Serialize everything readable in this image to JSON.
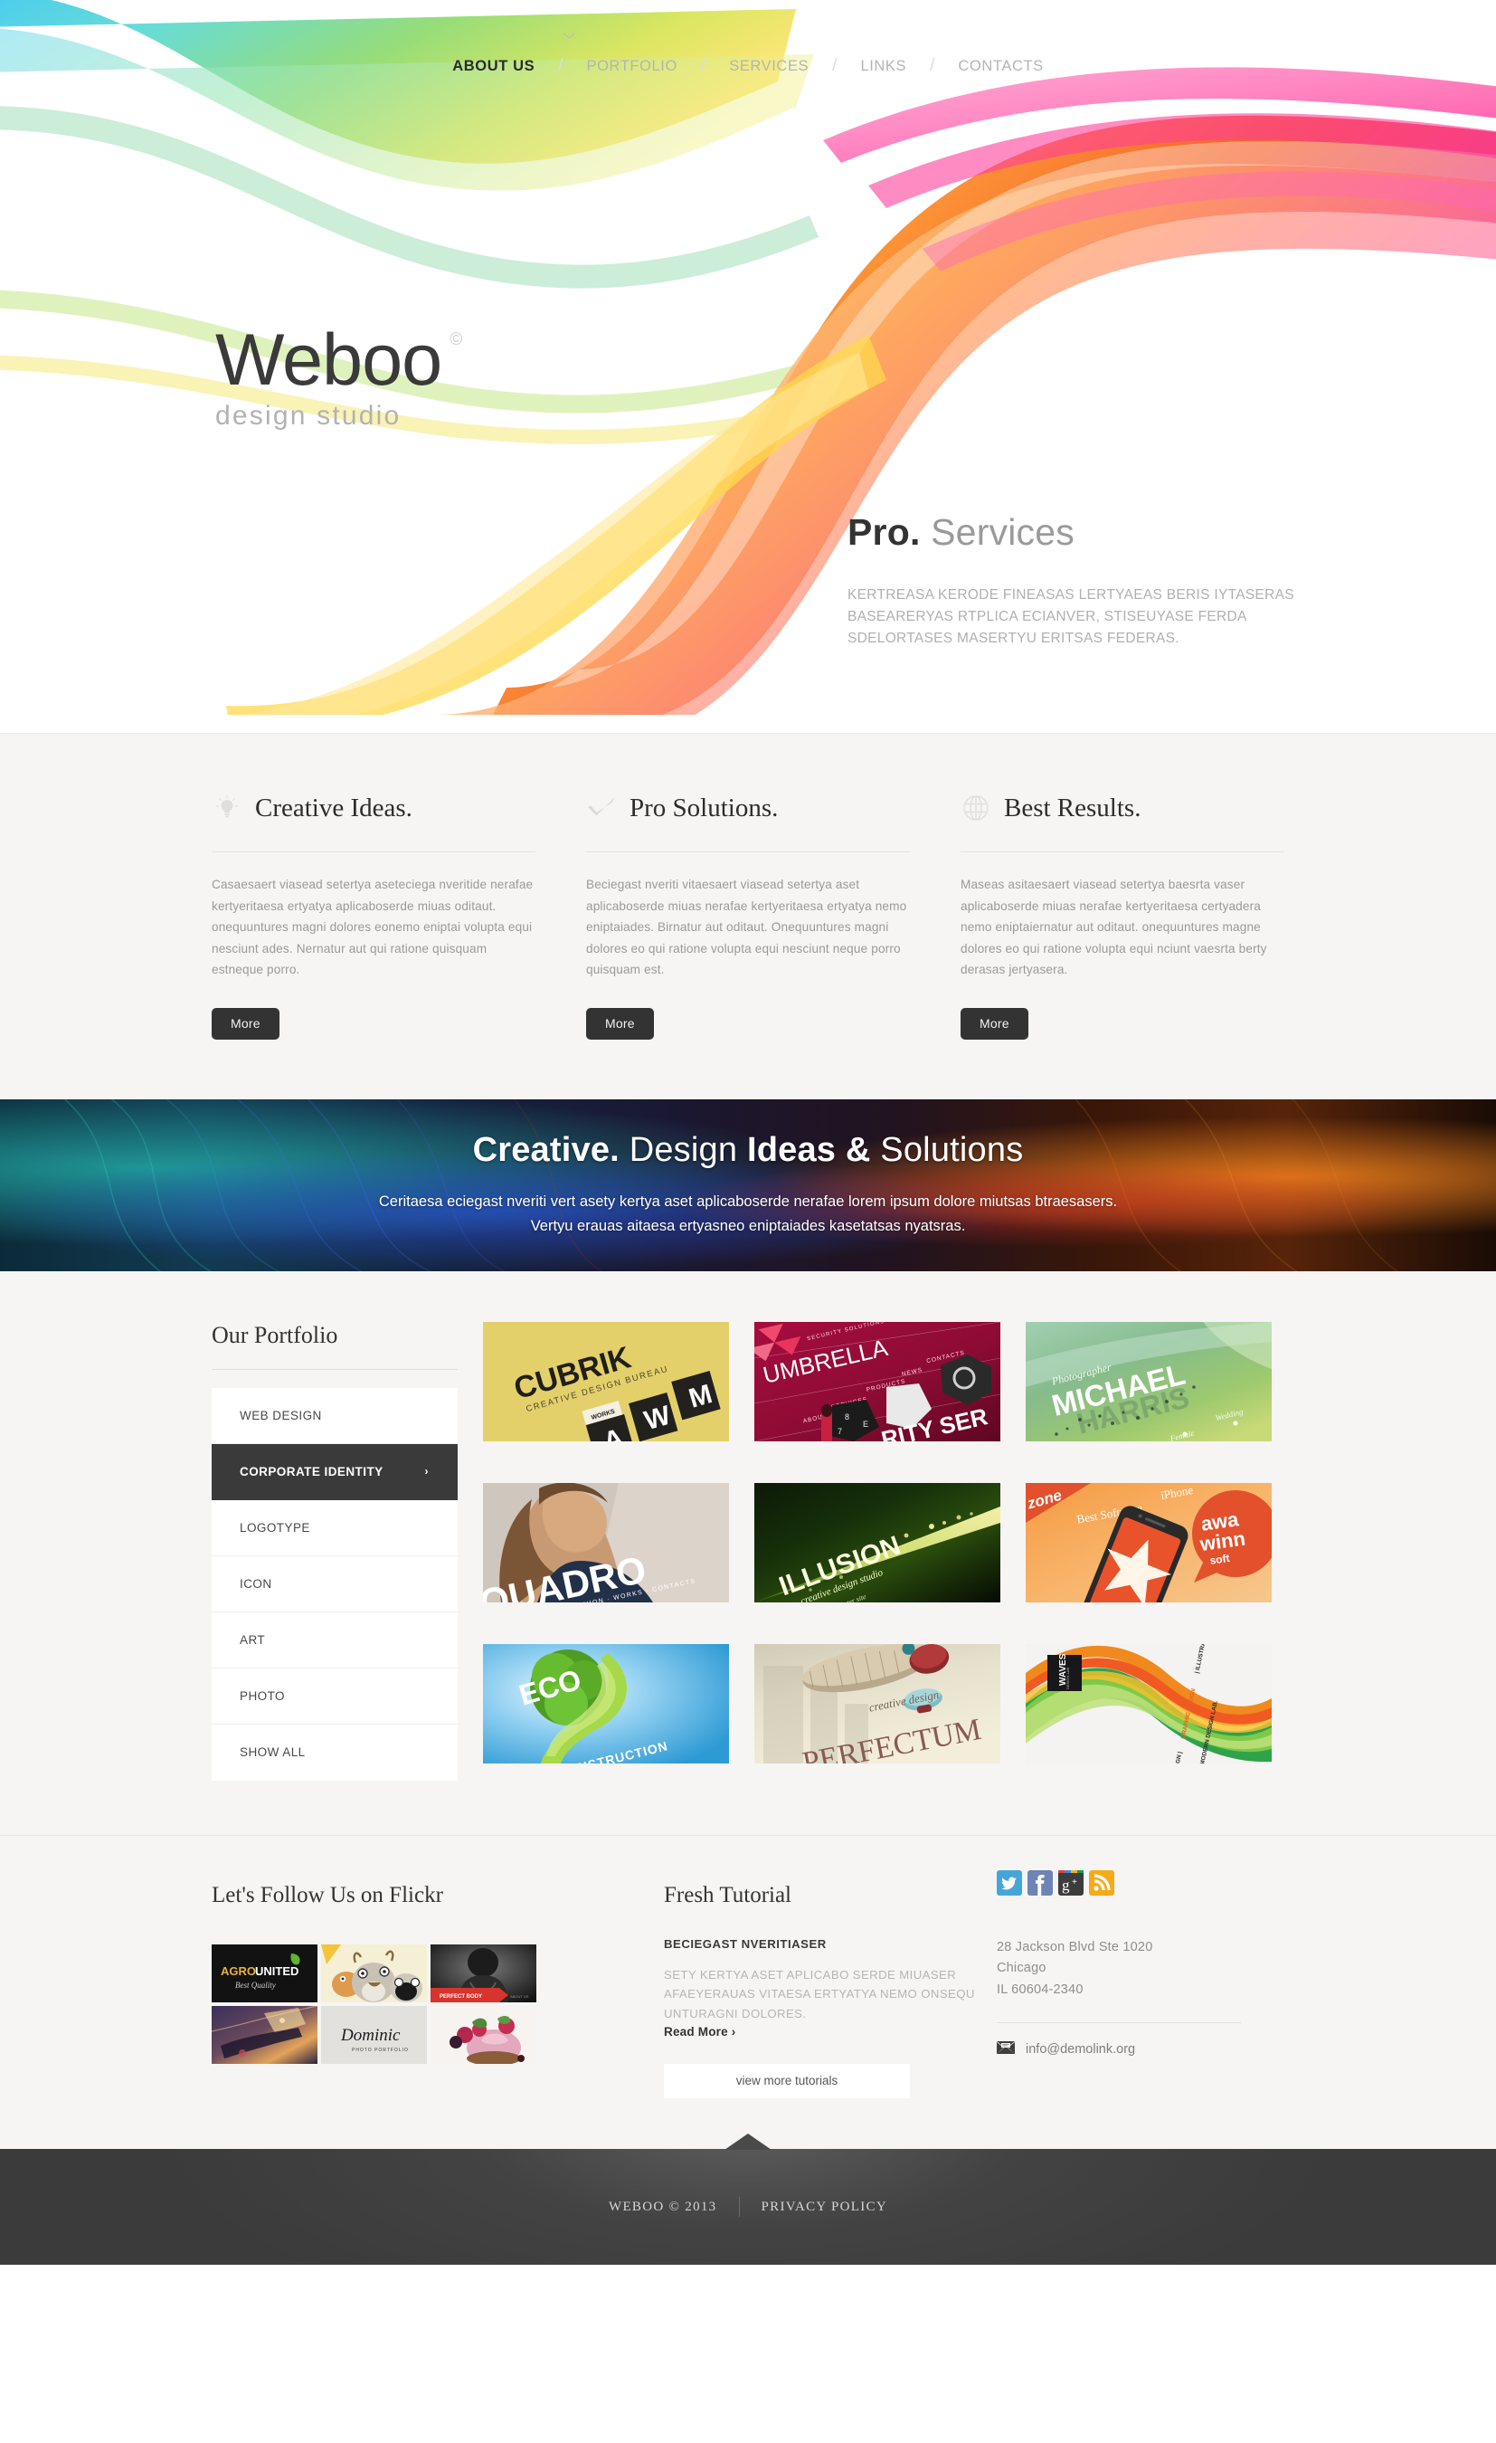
{
  "nav": {
    "caret_icon": "chevron-down-icon",
    "items": [
      {
        "label": "ABOUT US",
        "active": true
      },
      {
        "label": "PORTFOLIO",
        "active": false
      },
      {
        "label": "SERVICES",
        "active": false
      },
      {
        "label": "LINKS",
        "active": false
      },
      {
        "label": "CONTACTS",
        "active": false
      }
    ],
    "separator": "/"
  },
  "logo": {
    "name": "Weboo",
    "registered_mark": "©",
    "tagline": "design studio"
  },
  "hero": {
    "title_bold": "Pro.",
    "title_light": "Services",
    "description": "KERTREASA KERODE FINEASAS LERTYAEAS BERIS IYTASERAS BASEARERYAS RTPLICA ECIANVER, STISEUYASE FERDA SDELORTASES MASERTYU ERITSAS FEDERAS."
  },
  "features": {
    "columns": [
      {
        "icon": "lightbulb-icon",
        "title": "Creative Ideas.",
        "body": "Casaesaert viasead setertya aseteciega nveritide nerafae kertyeritaesa ertyatya aplicaboserde miuas  oditaut. onequuntures magni dolores eonemo eniptai volupta equi nesciunt ades. Nernatur aut qui ratione quisquam estneque porro.",
        "button": "More"
      },
      {
        "icon": "check-icon",
        "title": "Pro Solutions.",
        "body": "Beciegast nveriti vitaesaert viasead setertya aset aplicaboserde miuas nerafae kertyeritaesa ertyatya nemo eniptaiades. Birnatur aut oditaut. Onequuntures magni dolores eo qui ratione volupta equi nesciunt neque porro quisquam est.",
        "button": "More"
      },
      {
        "icon": "globe-icon",
        "title": "Best Results.",
        "body": "Maseas asitaesaert viasead setertya baesrta vaser aplicaboserde miuas nerafae kertyeritaesa  certyadera nemo eniptaiernatur aut oditaut. onequuntures magne dolores eo qui ratione volupta equi nciunt vaesrta berty derasas jertyasera.",
        "button": "More"
      }
    ]
  },
  "promo": {
    "title_part1": "Creative.",
    "title_part2": "Design",
    "title_part3": "Ideas &",
    "title_part4": "Solutions",
    "line1": "Ceritaesa eciegast nveriti vert asety kertya aset aplicaboserde nerafae lorem ipsum dolore miutsas btraesasers.",
    "line2": "Vertyu erauas aitaesa ertyasneo eniptaiades kasetatsas nyatsras."
  },
  "portfolio": {
    "heading": "Our Portfolio",
    "categories": [
      {
        "label": "WEB DESIGN",
        "active": false
      },
      {
        "label": "CORPORATE IDENTITY",
        "active": true
      },
      {
        "label": "LOGOTYPE",
        "active": false
      },
      {
        "label": "ICON",
        "active": false
      },
      {
        "label": "ART",
        "active": false
      },
      {
        "label": "PHOTO",
        "active": false
      },
      {
        "label": "SHOW ALL",
        "active": false
      }
    ],
    "active_arrow": "›",
    "items": [
      {
        "name": "CUBRIK",
        "sub": "CREATIVE DESIGN BUREAU",
        "tag": "WORKS"
      },
      {
        "name": "UMBRELLA",
        "sub": "SECURITY SERVICES",
        "tag": "SECURITY SOLUTIONS"
      },
      {
        "name": "MICHAEL HARRIS",
        "sub": "Photographer",
        "tag": "Female  Wedding"
      },
      {
        "name": "QUADRO",
        "sub": "FASHION · WORKS · CONTACTS",
        "tag": ""
      },
      {
        "name": "ILLUSION",
        "sub": "creative design studio",
        "tag": "enter site"
      },
      {
        "name": "iZone",
        "sub": "Best Software iPhone",
        "tag": "award winning software"
      },
      {
        "name": "ECO",
        "sub": "CONSTRUCTION",
        "tag": ""
      },
      {
        "name": "PERFECTUM",
        "sub": "creative design",
        "tag": ""
      },
      {
        "name": "WAVES",
        "sub": "DESIGN LAB",
        "tag": "WEB DESIGN | GRAPHIC DESIGN | ILLUSTRATIONS AND PHOTOS BY MODERN DESIGN LAB."
      }
    ]
  },
  "footer": {
    "flickr": {
      "heading": "Let's Follow Us on Flickr",
      "photos": [
        {
          "name": "AGRO.UNITED",
          "sub": "Best Quality"
        },
        {
          "name": "cartoon-animals",
          "sub": ""
        },
        {
          "name": "PERFECT BODY",
          "sub": ""
        },
        {
          "name": "guitar-night",
          "sub": ""
        },
        {
          "name": "Dominic",
          "sub": "PHOTO PORTFOLIO"
        },
        {
          "name": "berry-cake",
          "sub": ""
        }
      ]
    },
    "tutorial": {
      "heading": "Fresh Tutorial",
      "post_title": "BECIEGAST NVERITIASER",
      "post_body": "SETY KERTYA ASET APLICABO SERDE MIUASER AFAEYERAUAS VITAESA ERTYATYA NEMO ONSEQU UNTURAGNI DOLORES.",
      "read_more": "Read More",
      "read_more_arrow": "›",
      "button": "view more tutorials"
    },
    "contacts": {
      "socials": [
        {
          "name": "twitter-icon",
          "glyph": "t"
        },
        {
          "name": "facebook-icon",
          "glyph": "f"
        },
        {
          "name": "google-plus-icon",
          "glyph": "g+"
        },
        {
          "name": "rss-icon",
          "glyph": "rss"
        }
      ],
      "address_line1": "28 Jackson Blvd Ste 1020",
      "address_line2": "Chicago",
      "address_line3": "IL 60604-2340",
      "email_icon": "envelope-icon",
      "email": "info@demolink.org"
    }
  },
  "bottom": {
    "to_top_icon": "scroll-to-top-icon",
    "copyright": "WEBOO © 2013",
    "privacy": "PRIVACY POLICY"
  },
  "colors": {
    "accent_dark": "#333333",
    "page_bg": "#f6f5f3",
    "twitter": "#46a5d8",
    "facebook": "#6d84b4",
    "google_plus": "#3c3c3c",
    "rss": "#f5ab18"
  }
}
